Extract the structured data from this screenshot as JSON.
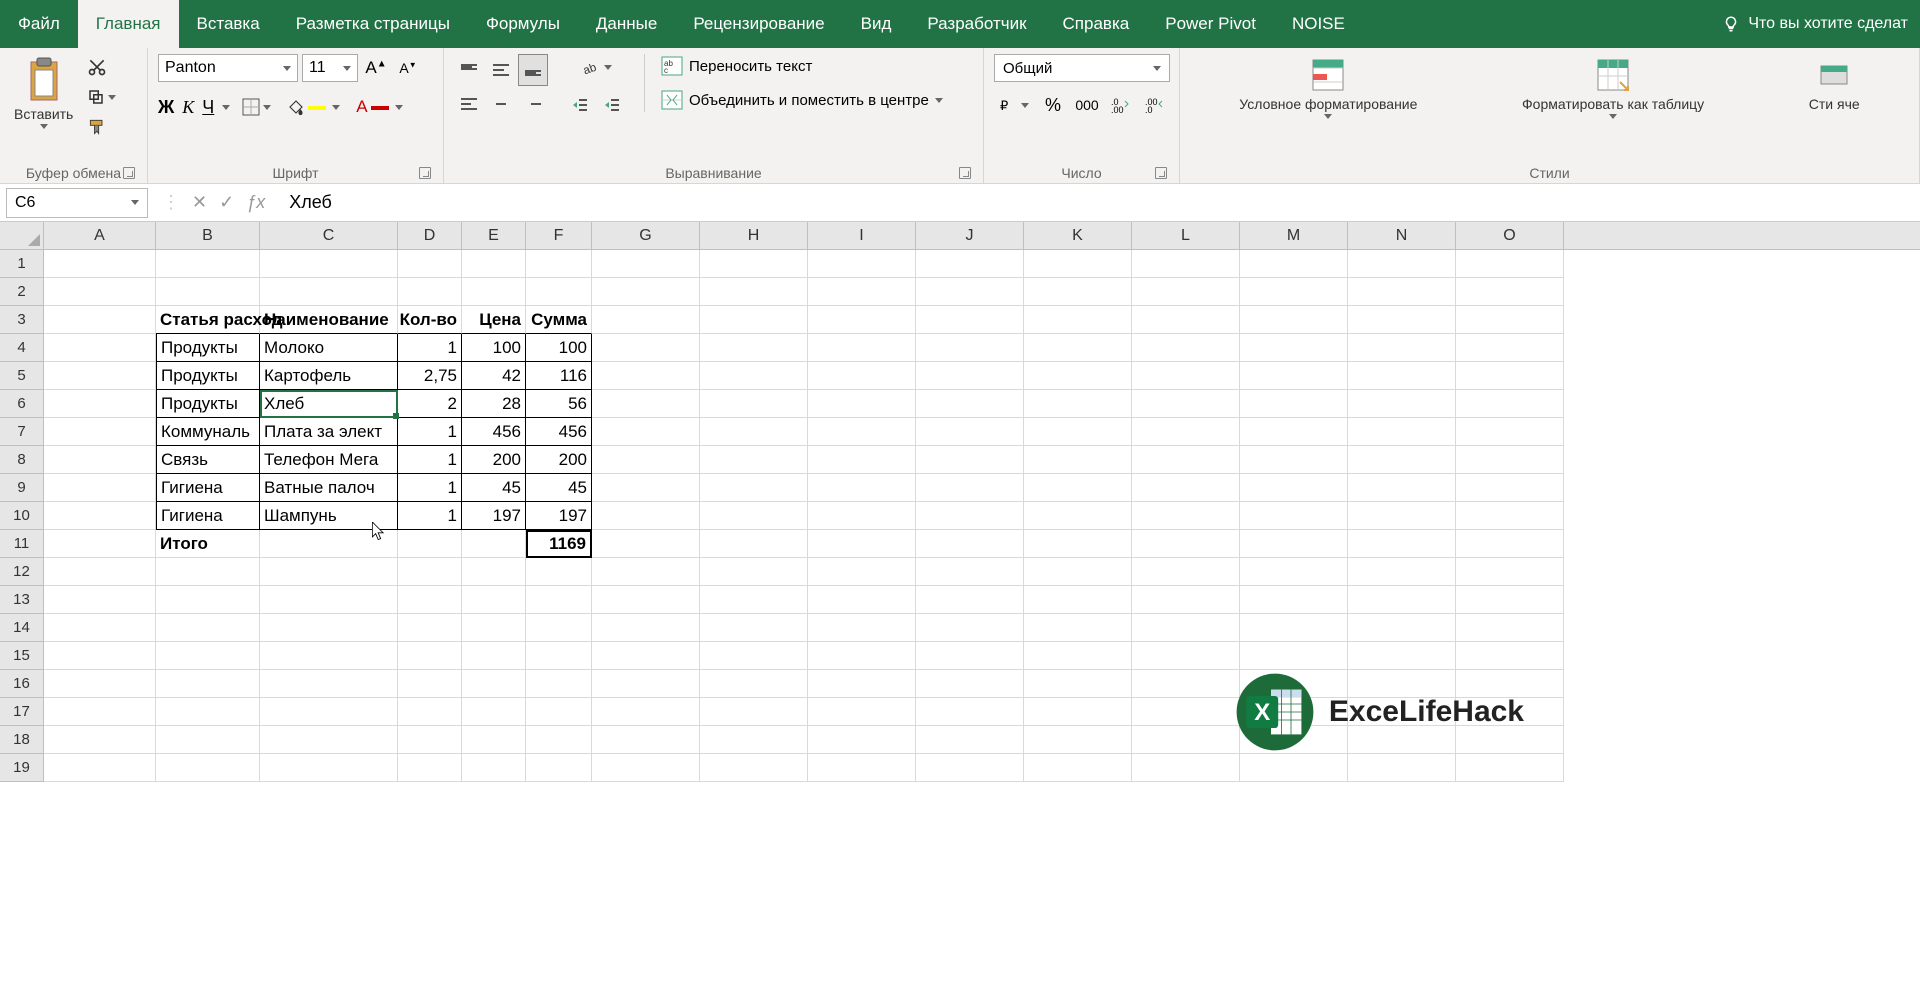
{
  "tabs": [
    "Файл",
    "Главная",
    "Вставка",
    "Разметка страницы",
    "Формулы",
    "Данные",
    "Рецензирование",
    "Вид",
    "Разработчик",
    "Справка",
    "Power Pivot",
    "NOISE"
  ],
  "active_tab": "Главная",
  "tell_me": "Что вы хотите сделат",
  "ribbon": {
    "clipboard": {
      "paste": "Вставить",
      "label": "Буфер обмена"
    },
    "font": {
      "name": "Panton",
      "size": "11",
      "label": "Шрифт"
    },
    "alignment": {
      "wrap": "Переносить текст",
      "merge": "Объединить и поместить в центре",
      "label": "Выравнивание"
    },
    "number": {
      "format": "Общий",
      "label": "Число"
    },
    "styles": {
      "cond": "Условное форматирование",
      "table": "Форматировать как таблицу",
      "cell": "Сти яче",
      "label": "Стили"
    }
  },
  "namebox": "C6",
  "formula": "Хлеб",
  "columns": [
    "A",
    "B",
    "C",
    "D",
    "E",
    "F",
    "G",
    "H",
    "I",
    "J",
    "K",
    "L",
    "M",
    "N",
    "O"
  ],
  "chart_data": {
    "type": "table",
    "headers": [
      "Статья расход",
      "Наименование",
      "Кол-во",
      "Цена",
      "Сумма"
    ],
    "rows": [
      [
        "Продукты",
        "Молоко",
        "1",
        "100",
        "100"
      ],
      [
        "Продукты",
        "Картофель",
        "2,75",
        "42",
        "116"
      ],
      [
        "Продукты",
        "Хлеб",
        "2",
        "28",
        "56"
      ],
      [
        "Коммуналь",
        "Плата за элект",
        "1",
        "456",
        "456"
      ],
      [
        "Связь",
        "Телефон Мега",
        "1",
        "200",
        "200"
      ],
      [
        "Гигиена",
        "Ватные палоч",
        "1",
        "45",
        "45"
      ],
      [
        "Гигиена",
        "Шампунь",
        "1",
        "197",
        "197"
      ]
    ],
    "footer": {
      "label": "Итого",
      "sum": "1169"
    }
  },
  "selected_cell": "C6",
  "watermark": "ExceLifeHack"
}
